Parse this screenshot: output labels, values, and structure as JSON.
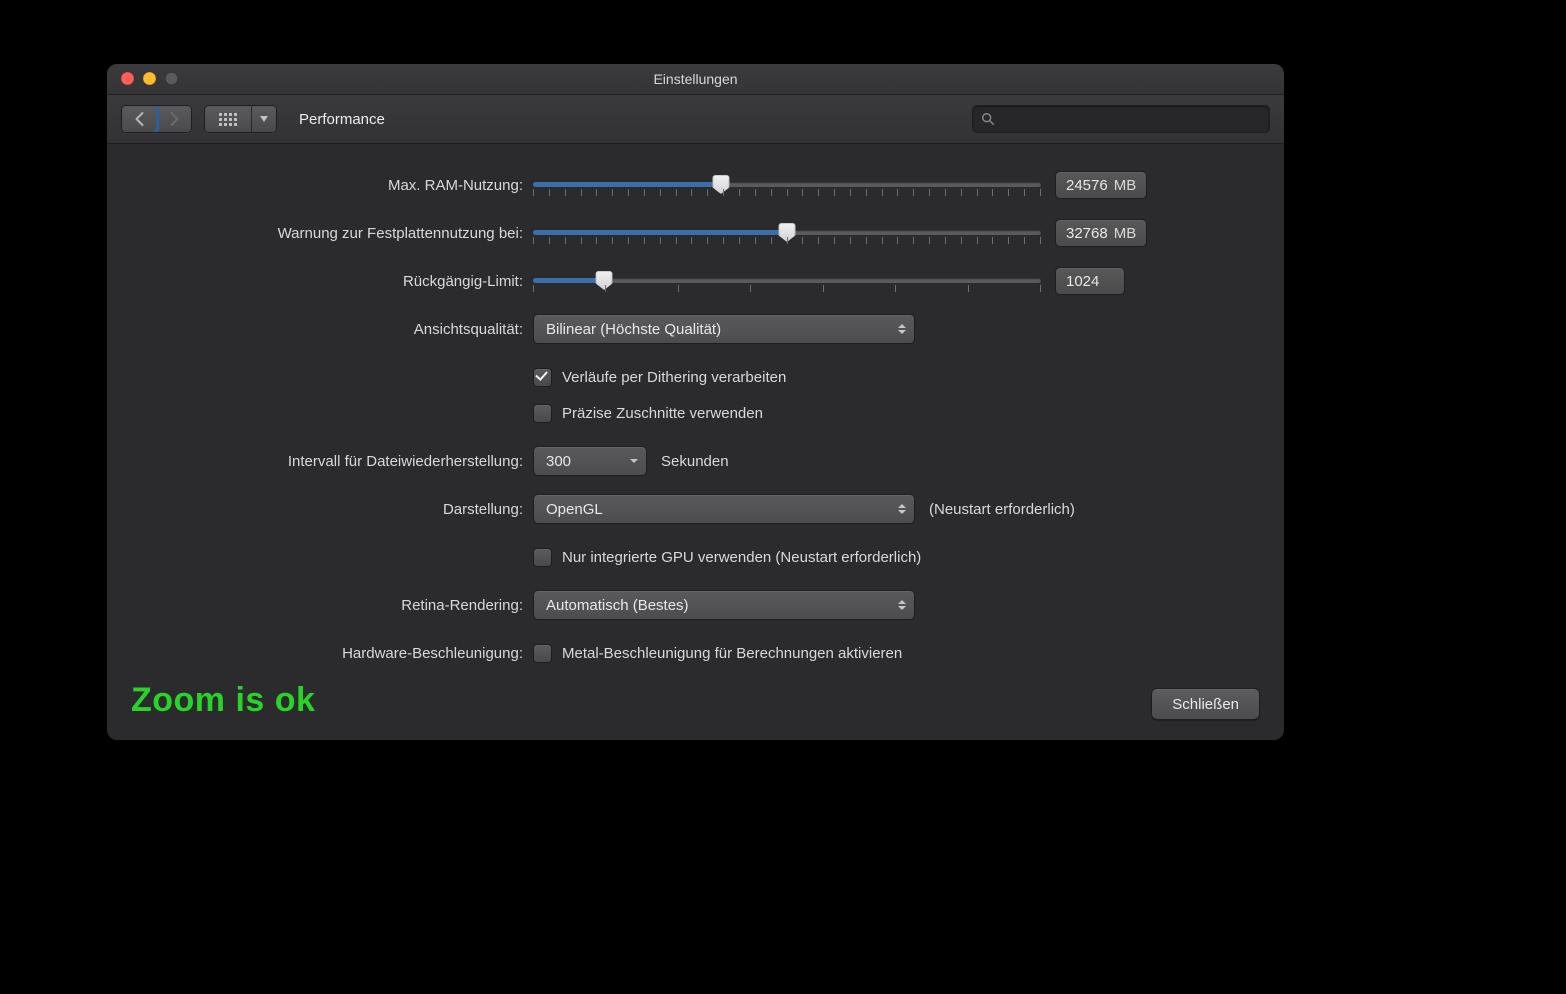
{
  "window": {
    "title": "Einstellungen",
    "section": "Performance"
  },
  "search": {
    "placeholder": ""
  },
  "settings": {
    "ram": {
      "label": "Max. RAM-Nutzung:",
      "value": "24576",
      "unit": "MB",
      "pct": 37
    },
    "disk": {
      "label": "Warnung zur Festplattennutzung bei:",
      "value": "32768",
      "unit": "MB",
      "pct": 50
    },
    "undo": {
      "label": "Rückgängig-Limit:",
      "value": "1024",
      "pct": 14
    },
    "viewq": {
      "label": "Ansichtsqualität:",
      "value": "Bilinear (Höchste Qualität)"
    },
    "dither": {
      "label": "Verläufe per Dithering verarbeiten",
      "checked": true
    },
    "precise": {
      "label": "Präzise Zuschnitte verwenden",
      "checked": false
    },
    "recovery": {
      "label": "Intervall für Dateiwiederherstellung:",
      "value": "300",
      "unit": "Sekunden"
    },
    "display": {
      "label": "Darstellung:",
      "value": "OpenGL",
      "hint": "(Neustart erforderlich)"
    },
    "igpu": {
      "label": "Nur integrierte GPU verwenden (Neustart erforderlich)",
      "checked": false
    },
    "retina": {
      "label": "Retina-Rendering:",
      "value": "Automatisch (Bestes)"
    },
    "hwaccel": {
      "label": "Hardware-Beschleunigung:",
      "option": "Metal-Beschleunigung für Berechnungen aktivieren",
      "checked": false
    }
  },
  "overlay": "Zoom is ok",
  "close": "Schließen"
}
